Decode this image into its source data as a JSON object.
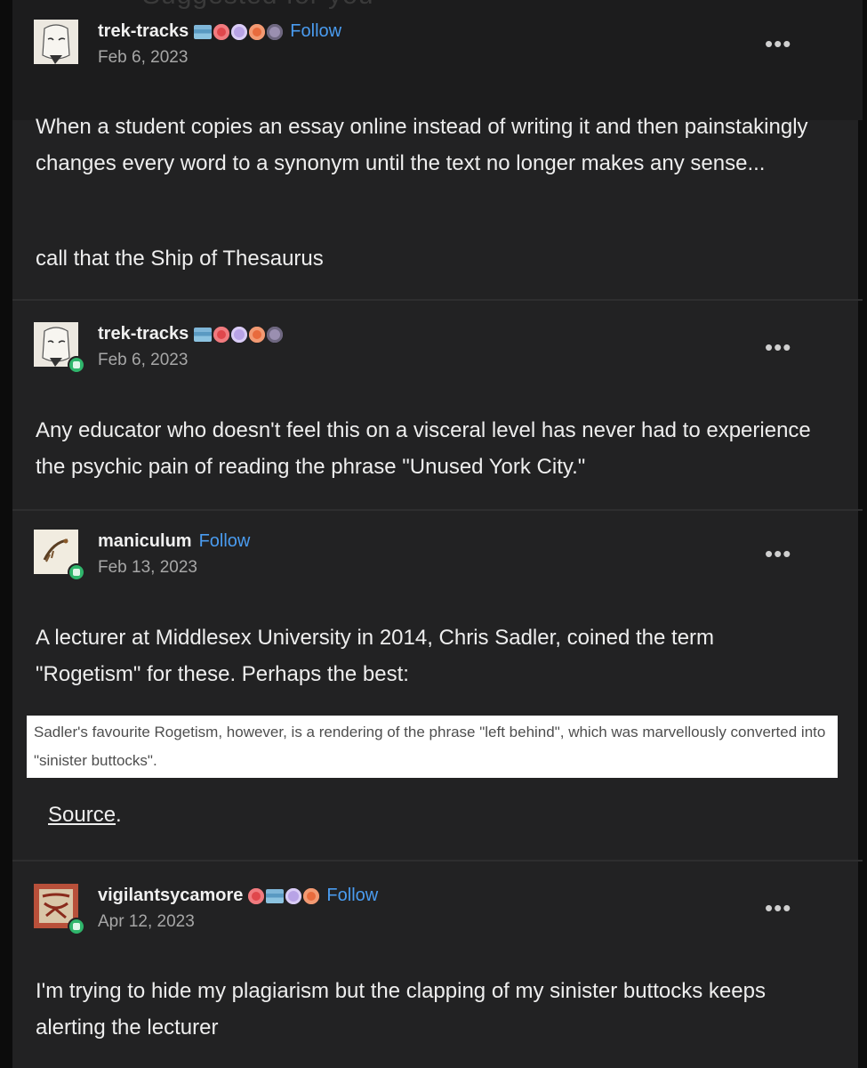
{
  "top_fragment": "Suggested for you",
  "posts": [
    {
      "username": "trek-tracks",
      "follow": "Follow",
      "date": "Feb 6, 2023",
      "paragraphs": [
        "When a student copies an essay online instead of writing it and then painstakingly changes every word to a synonym until the text no longer makes any sense...",
        "call that the Ship of Thesaurus"
      ]
    },
    {
      "username": "trek-tracks",
      "date": "Feb 6, 2023",
      "paragraphs": [
        "Any educator who doesn't feel this on a visceral level has never had to experience the psychic pain of reading the phrase \"Unused York City.\""
      ]
    },
    {
      "username": "maniculum",
      "follow": "Follow",
      "date": "Feb 13, 2023",
      "paragraphs": [
        "A lecturer at Middlesex University in 2014, Chris Sadler, coined the term \"Rogetism\" for these. Perhaps the best:"
      ],
      "quote": "Sadler's favourite Rogetism, however, is a rendering of the phrase \"left behind\", which was marvellously converted into \"sinister buttocks\".",
      "source_label": "Source",
      "source_suffix": "."
    },
    {
      "username": "vigilantsycamore",
      "follow": "Follow",
      "date": "Apr 12, 2023",
      "paragraphs": [
        "I'm trying to hide my plagiarism but the clapping of my sinister buttocks keeps alerting the lecturer"
      ]
    }
  ],
  "more_label": "•••",
  "colors": {
    "background": "#222223",
    "follow": "#4a9cf0",
    "badge": "#2fb56b"
  }
}
